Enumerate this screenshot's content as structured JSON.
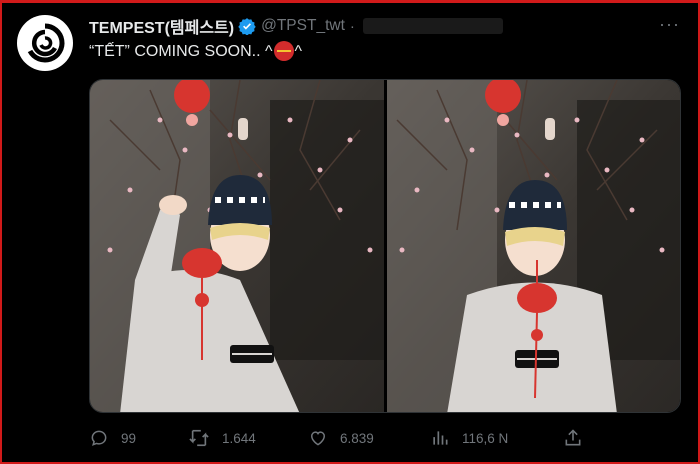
{
  "tweet": {
    "author_name": "TEMPEST(템페스트)",
    "handle": "@TPST_twt",
    "separator": "·",
    "text_prefix": "“TẾT” COMING SOON.. ^",
    "text_suffix": "^",
    "emoji": "lantern-emoji",
    "more": "···"
  },
  "media": {
    "photos": [
      {
        "description_icon": "photo-1"
      },
      {
        "description_icon": "photo-2"
      }
    ]
  },
  "actions": {
    "replies": "99",
    "retweets": "1.644",
    "likes": "6.839",
    "views": "116,6 N"
  },
  "colors": {
    "background": "#000000",
    "text": "#e7e9ea",
    "muted": "#71767b",
    "verified": "#1d9bf0",
    "frame": "#d11a1a"
  }
}
